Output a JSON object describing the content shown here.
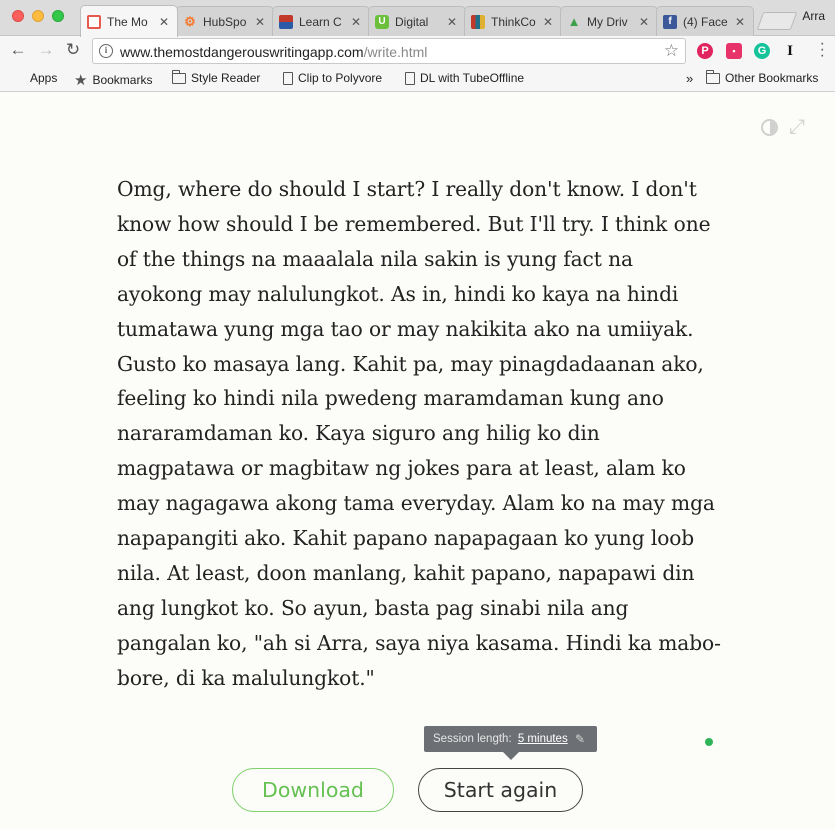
{
  "browser": {
    "profile_name": "Arra",
    "tabs": [
      {
        "title": "The Mo",
        "icon": "red-square-icon",
        "color": "#e55a4e",
        "active": true
      },
      {
        "title": "HubSpo",
        "icon": "hubspot-icon",
        "color": "#f57a2f",
        "active": false
      },
      {
        "title": "Learn C",
        "icon": "learn-icon",
        "color": "#2a5aa8",
        "active": false
      },
      {
        "title": "Digital",
        "icon": "u-icon",
        "color": "#6bbf3a",
        "active": false
      },
      {
        "title": "ThinkCo",
        "icon": "thinkco-icon",
        "color": "#1f6f88",
        "active": false
      },
      {
        "title": "My Driv",
        "icon": "drive-icon",
        "color": "#3f9f4a",
        "active": false
      },
      {
        "title": "(4) Face",
        "icon": "facebook-icon",
        "color": "#3b5998",
        "active": false
      }
    ],
    "address": {
      "host": "www.themostdangerouswritingapp.com",
      "path": "/write.html"
    },
    "bookmarks": [
      {
        "label": "Apps",
        "icon": "apps-icon"
      },
      {
        "label": "Bookmarks",
        "icon": "star-icon"
      },
      {
        "label": "Style Reader",
        "icon": "folder-icon"
      },
      {
        "label": "Clip to Polyvore",
        "icon": "page-icon"
      },
      {
        "label": "DL with TubeOffline",
        "icon": "page-icon"
      }
    ],
    "overflow_label": "»",
    "other_bookmarks": "Other Bookmarks"
  },
  "editor": {
    "text": "Omg, where do should I start? I really don't know. I don't know how should I be remembered. But I'll try. I think one of the things na maaalala nila sakin is yung fact na ayokong may nalulungkot. As in, hindi ko kaya na hindi tumatawa yung mga tao or may nakikita ako na umiiyak. Gusto ko masaya lang. Kahit pa, may pinagdadaanan ako, feeling ko hindi nila pwedeng maramdaman kung ano nararamdaman ko. Kaya siguro ang hilig ko din magpatawa or magbitaw ng jokes para at least, alam ko may nagagawa akong tama everyday. Alam ko na may mga napapangiti ako. Kahit papano napapagaan ko yung loob nila. At least, doon manlang, kahit papano, napapawi din ang lungkot ko. So ayun, basta pag sinabi nila ang pangalan ko, \"ah si Arra, saya niya kasama. Hindi ka mabo-bore, di ka malulungkot.\""
  },
  "session": {
    "label": "Session length:",
    "value": "5 minutes"
  },
  "actions": {
    "download": "Download",
    "restart": "Start again"
  },
  "colors": {
    "download_green": "#66c153",
    "status_green": "#2fb45a",
    "tooltip_bg": "#6c6f73"
  }
}
